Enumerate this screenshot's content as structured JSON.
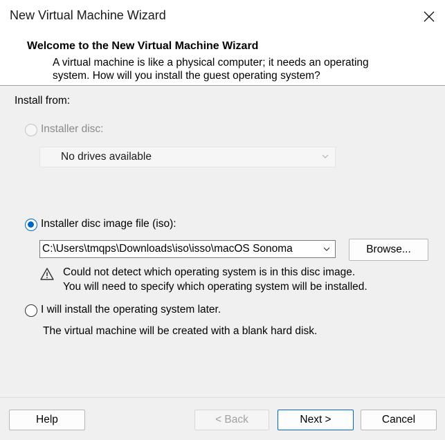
{
  "window": {
    "title": "New Virtual Machine Wizard"
  },
  "header": {
    "title": "Welcome to the New Virtual Machine Wizard",
    "description_line1": "A virtual machine is like a physical computer; it needs an operating",
    "description_line2": "system. How will you install the guest operating system?"
  },
  "install": {
    "section_label": "Install from:",
    "selected_option": "Installer disc image file (iso):",
    "disc": {
      "label": "Installer disc:",
      "dropdown_value": "No drives available",
      "enabled": false
    },
    "iso": {
      "label": "Installer disc image file (iso):",
      "path_value": "C:\\Users\\tmqps\\Downloads\\iso\\isso\\macOS Sonoma",
      "browse_label": "Browse...",
      "warning_line1": "Could not detect which operating system is in this disc image.",
      "warning_line2": "You will need to specify which operating system will be installed."
    },
    "later": {
      "label": "I will install the operating system later.",
      "description": "The virtual machine will be created with a blank hard disk."
    }
  },
  "footer": {
    "help_label": "Help",
    "back_label": "< Back",
    "next_label": "Next >",
    "cancel_label": "Cancel"
  },
  "colors": {
    "accent": "#0067c0",
    "window_bg": "#f0f0f0",
    "header_bg": "#ffffff",
    "disabled_text": "#8a8a8a"
  },
  "icons": {
    "close": "close-icon",
    "warning": "warning-icon",
    "dropdown": "chevron-down-icon"
  }
}
